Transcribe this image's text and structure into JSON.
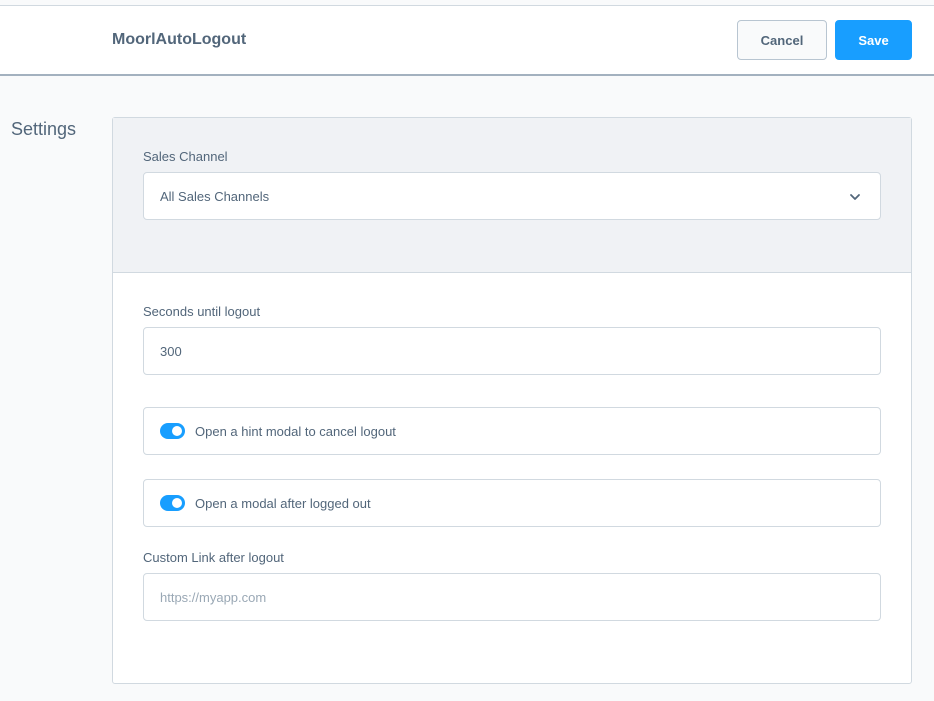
{
  "header": {
    "title": "MoorlAutoLogout",
    "cancel_label": "Cancel",
    "save_label": "Save"
  },
  "sidebar": {
    "section_label": "Settings"
  },
  "form": {
    "sales_channel": {
      "label": "Sales Channel",
      "value": "All Sales Channels"
    },
    "seconds_until_logout": {
      "label": "Seconds until logout",
      "value": "300"
    },
    "hint_modal_toggle": {
      "label": "Open a hint modal to cancel logout",
      "enabled": true
    },
    "logged_out_modal_toggle": {
      "label": "Open a modal after logged out",
      "enabled": true
    },
    "custom_link": {
      "label": "Custom Link after logout",
      "placeholder": "https://myapp.com",
      "value": ""
    }
  },
  "colors": {
    "accent": "#189eff",
    "text": "#52667a",
    "border": "#d1d9e0"
  }
}
